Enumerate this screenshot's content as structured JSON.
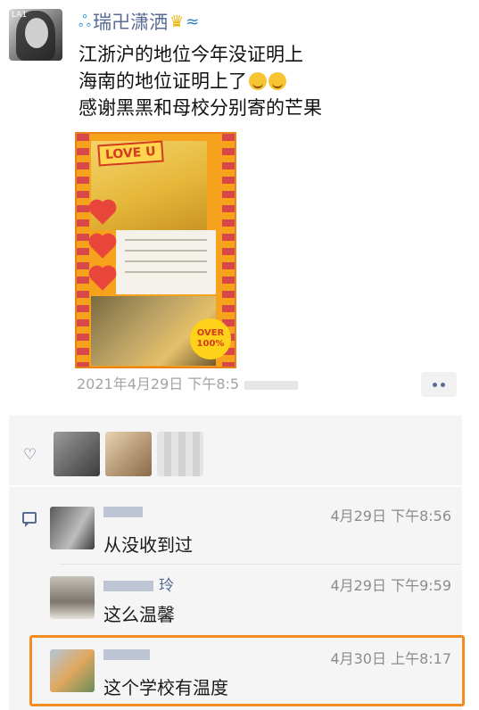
{
  "post": {
    "username": "瑞卍潇洒",
    "avatar_label": "LA1",
    "text_lines": [
      "江浙沪的地位今年没证明上",
      "海南的地位证明上了",
      "感谢黑黑和母校分别寄的芒果"
    ],
    "image": {
      "love_tag": "LOVE U",
      "badge_line1": "OVER",
      "badge_line2": "100%"
    },
    "timestamp": "2021年4月29日 下午8:5"
  },
  "comments": [
    {
      "name": "",
      "time": "4月29日 下午8:56",
      "text": "从没收到过"
    },
    {
      "name": "玲",
      "time": "4月29日 下午9:59",
      "text": "这么温馨"
    },
    {
      "name": "",
      "time": "4月30日 上午8:17",
      "text": "这个学校有温度"
    }
  ],
  "colors": {
    "link_blue": "#576b95",
    "highlight_orange": "#f28c1e",
    "panel_bg": "#f5f5f5"
  },
  "icons": [
    "heart-outline-icon",
    "comment-icon",
    "more-dots-icon",
    "crown-icon",
    "wave-icon"
  ]
}
